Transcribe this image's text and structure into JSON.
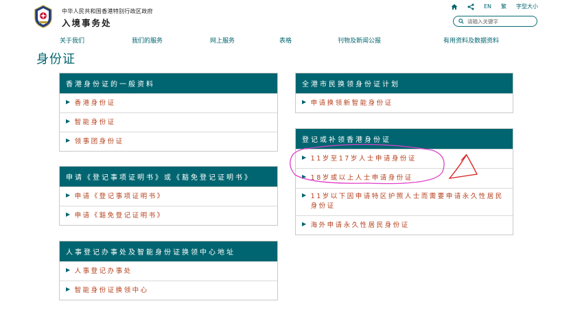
{
  "header": {
    "gov_name": "中华人民共和国香港特别行政区政府",
    "dept_name": "入境事务处",
    "util": {
      "lang_en": "EN",
      "lang_trad": "繁",
      "font_size": "字型大小"
    },
    "search": {
      "placeholder": "请输入关键字"
    }
  },
  "nav": {
    "items": [
      "关于我们",
      "我们的服务",
      "网上服务",
      "表格",
      "刊物及新闻公报",
      "有用资料及数据资料"
    ]
  },
  "page": {
    "title": "身份证"
  },
  "panels": {
    "general": {
      "header": "香港身份证的一般资料",
      "items": [
        "香港身份证",
        "智能身份证",
        "领事团身份证"
      ]
    },
    "apply_cert": {
      "header": "申请《登记事项证明书》或《豁免登记证明书》",
      "items": [
        "申请《登记事项证明书》",
        "申请《豁免登记证明书》"
      ]
    },
    "office": {
      "header": "人事登记办事处及智能身份证换领中心地址",
      "items": [
        "人事登记办事处",
        "智能身份证换领中心"
      ]
    },
    "replacement": {
      "header": "全港市民换领身份证计划",
      "items": [
        "申请换领新智能身份证"
      ]
    },
    "register": {
      "header": "登记或补领香港身份证",
      "items": [
        "11岁至17岁人士申请身份证",
        "18岁或以上人士申请身份证",
        "11岁以下因申请特区护照人士而需要申请永久性居民身份证",
        "海外申请永久性居民身份证"
      ]
    }
  },
  "colors": {
    "brand_teal": "#006570",
    "link_orange": "#b5401c",
    "annotation_magenta": "#e040c8",
    "annotation_red": "#d81c1c"
  }
}
